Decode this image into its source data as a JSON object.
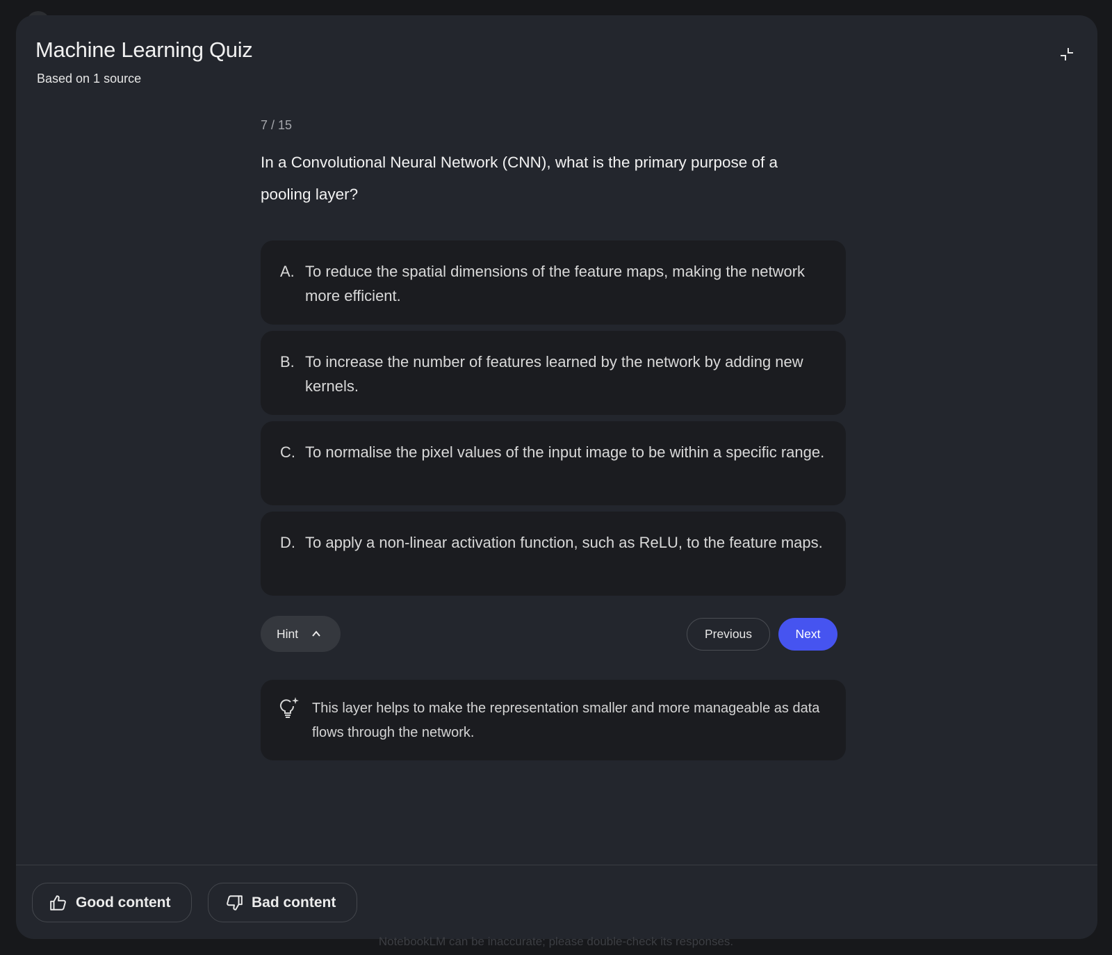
{
  "header": {
    "title": "Machine Learning Quiz",
    "subtitle": "Based on 1 source",
    "collapse_icon": "collapse-icon"
  },
  "quiz": {
    "progress": "7 / 15",
    "question": "In a Convolutional Neural Network (CNN), what is the primary purpose of a pooling layer?",
    "options": [
      {
        "letter": "A.",
        "text": "To reduce the spatial dimensions of the feature maps, making the network more efficient."
      },
      {
        "letter": "B.",
        "text": "To increase the number of features learned by the network by adding new kernels."
      },
      {
        "letter": "C.",
        "text": "To normalise the pixel values of the input image to be within a specific range."
      },
      {
        "letter": "D.",
        "text": "To apply a non-linear activation function, such as ReLU, to the feature maps."
      }
    ]
  },
  "controls": {
    "hint_label": "Hint",
    "previous_label": "Previous",
    "next_label": "Next"
  },
  "hint": {
    "icon": "lightbulb-sparkle-icon",
    "text": "This layer helps to make the representation smaller and more manageable as data flows through the network."
  },
  "feedback": {
    "good_label": "Good content",
    "bad_label": "Bad content"
  },
  "disclaimer": "NotebookLM can be inaccurate; please double-check its responses.",
  "colors": {
    "background": "#17181b",
    "dialog": "#23262d",
    "card": "#1b1c20",
    "accent": "#4654f0"
  }
}
